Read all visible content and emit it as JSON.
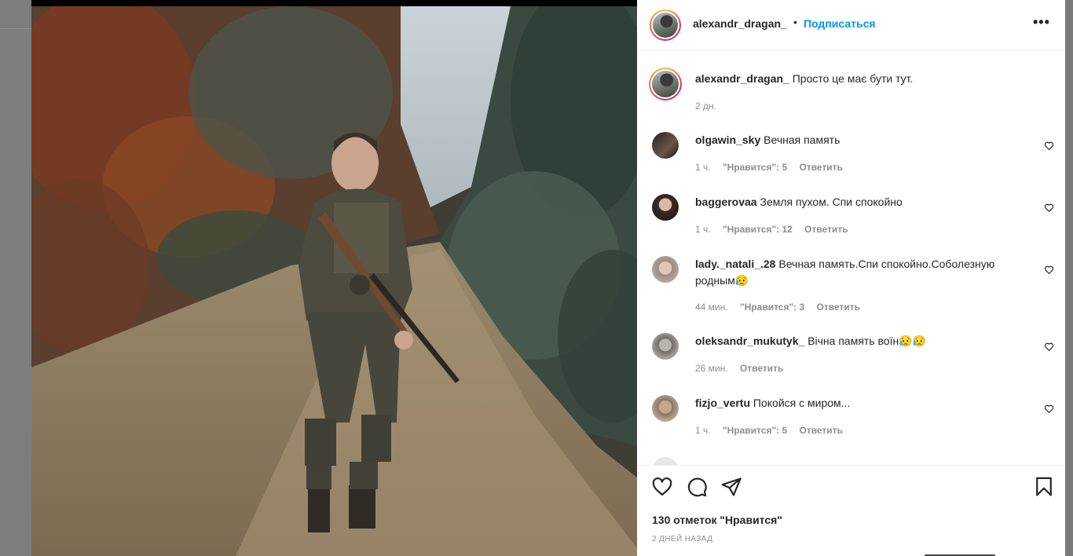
{
  "post": {
    "author": "alexandr_dragan_",
    "separator": "•",
    "follow_label": "Подписаться",
    "more_label": "•••",
    "caption_user": "alexandr_dragan_",
    "caption_text": "Просто це має бути тут.",
    "caption_time": "2 дн.",
    "likes_text": "130 отметок \"Нравится\"",
    "date_text": "2 ДНЕЙ НАЗАД"
  },
  "comments": [
    {
      "user": "olgawin_sky",
      "text": "Вечная память",
      "time": "1 ч.",
      "likes": "\"Нравится\": 5",
      "reply": "Ответить"
    },
    {
      "user": "baggerovaa",
      "text": "Земля пухом. Спи спокойно",
      "time": "1 ч.",
      "likes": "\"Нравится\": 12",
      "reply": "Ответить"
    },
    {
      "user": "lady._natali_.28",
      "text": "Вечная память.Спи спокойно.Соболезную родным😥",
      "time": "44 мин.",
      "likes": "\"Нравится\": 3",
      "reply": "Ответить"
    },
    {
      "user": "oleksandr_mukutyk_",
      "text": "Вічна память воїн😥😥",
      "time": "26 мин.",
      "likes": "",
      "reply": "Ответить"
    },
    {
      "user": "fizjo_vertu",
      "text": "Покойся с миром...",
      "time": "1 ч.",
      "likes": "\"Нравится\": 5",
      "reply": "Ответить"
    }
  ],
  "icons": {
    "like": "heart-icon",
    "comment": "comment-icon",
    "share": "share-icon",
    "save": "bookmark-icon",
    "comment_like": "heart-icon",
    "options": "more-options-icon"
  },
  "colors": {
    "follow": "#0095f6",
    "meta": "#8e8e8e",
    "text": "#262626"
  }
}
